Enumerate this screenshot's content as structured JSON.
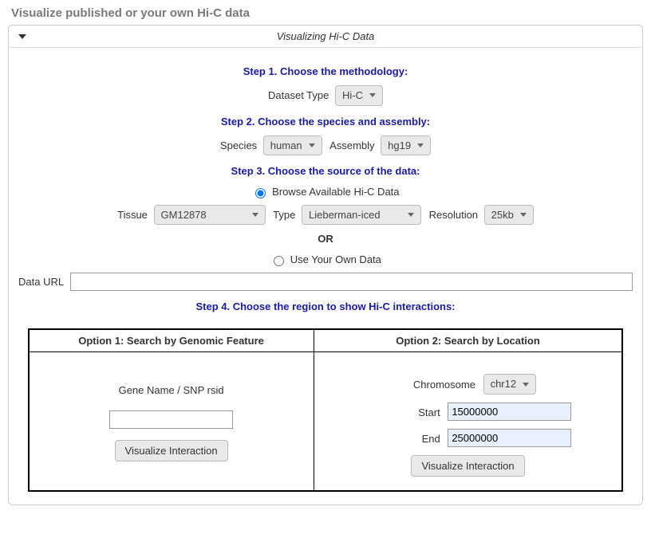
{
  "title": "Visualize published or your own Hi-C data",
  "panel_title": "Visualizing Hi-C Data",
  "steps": {
    "s1": "Step 1. Choose the methodology:",
    "s2": "Step 2. Choose the species and assembly:",
    "s3": "Step 3. Choose the source of the data:",
    "s4": "Step 4. Choose the region to show Hi-C interactions:"
  },
  "labels": {
    "dataset_type": "Dataset Type",
    "species": "Species",
    "assembly": "Assembly",
    "browse_avail": "Browse Available Hi-C Data",
    "tissue": "Tissue",
    "type": "Type",
    "resolution": "Resolution",
    "or": "OR",
    "use_own": "Use Your Own Data",
    "data_url": "Data URL",
    "option1": "Option 1: Search by Genomic Feature",
    "option2": "Option 2: Search by Location",
    "gene_snp": "Gene Name / SNP rsid",
    "chromosome": "Chromosome",
    "start": "Start",
    "end": "End",
    "visualize": "Visualize Interaction"
  },
  "values": {
    "dataset_type": "Hi-C",
    "species": "human",
    "assembly": "hg19",
    "tissue": "GM12878",
    "type": "Lieberman-iced",
    "resolution": "25kb",
    "data_url": "",
    "gene_snp": "",
    "chromosome": "chr12",
    "start": "15000000",
    "end": "25000000"
  },
  "radio": {
    "browse_checked": true,
    "own_checked": false
  }
}
